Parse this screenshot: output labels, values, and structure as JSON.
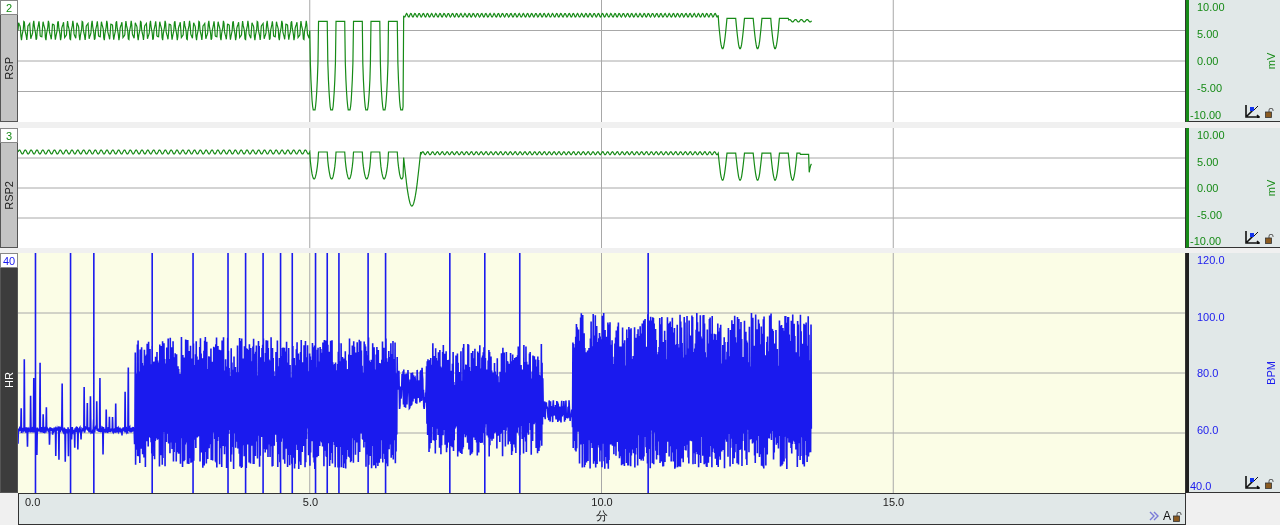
{
  "channels": [
    {
      "number": "2",
      "label": "RSP",
      "kind": "rsp",
      "color": "#168a16",
      "selected": false,
      "ticks": [
        "10.00",
        "5.00",
        "0.00",
        "-5.00",
        "-10.00"
      ],
      "unit": "mV"
    },
    {
      "number": "3",
      "label": "RSP2",
      "kind": "rsp2",
      "color": "#168a16",
      "selected": false,
      "ticks": [
        "10.00",
        "5.00",
        "0.00",
        "-5.00",
        "-10.00"
      ],
      "unit": "mV"
    },
    {
      "number": "40",
      "label": "HR",
      "kind": "hr",
      "color": "#1a1aee",
      "selected": true,
      "ticks": [
        "120.0",
        "100.0",
        "80.0",
        "60.0",
        "40.0"
      ],
      "unit": "BPM"
    }
  ],
  "time_axis": {
    "ticks": [
      "0.0",
      "5.0",
      "10.0",
      "15.0"
    ],
    "unit": "分",
    "mode_label": "A"
  }
}
